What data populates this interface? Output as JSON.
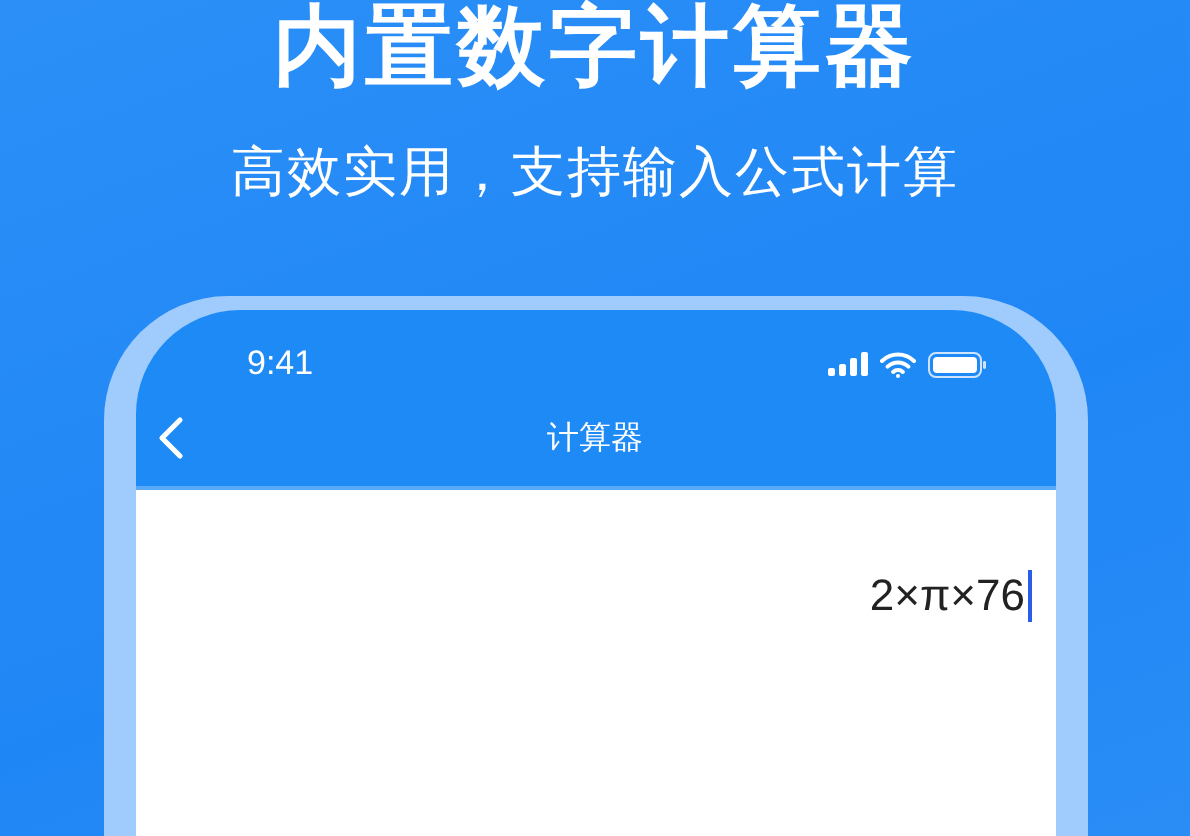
{
  "headline": "内置数字计算器",
  "subtitle": "高效实用，支持输入公式计算",
  "phone": {
    "status_bar": {
      "time": "9:41"
    },
    "nav_bar": {
      "title": "计算器"
    },
    "display": {
      "expression": "2×π×76"
    }
  }
}
